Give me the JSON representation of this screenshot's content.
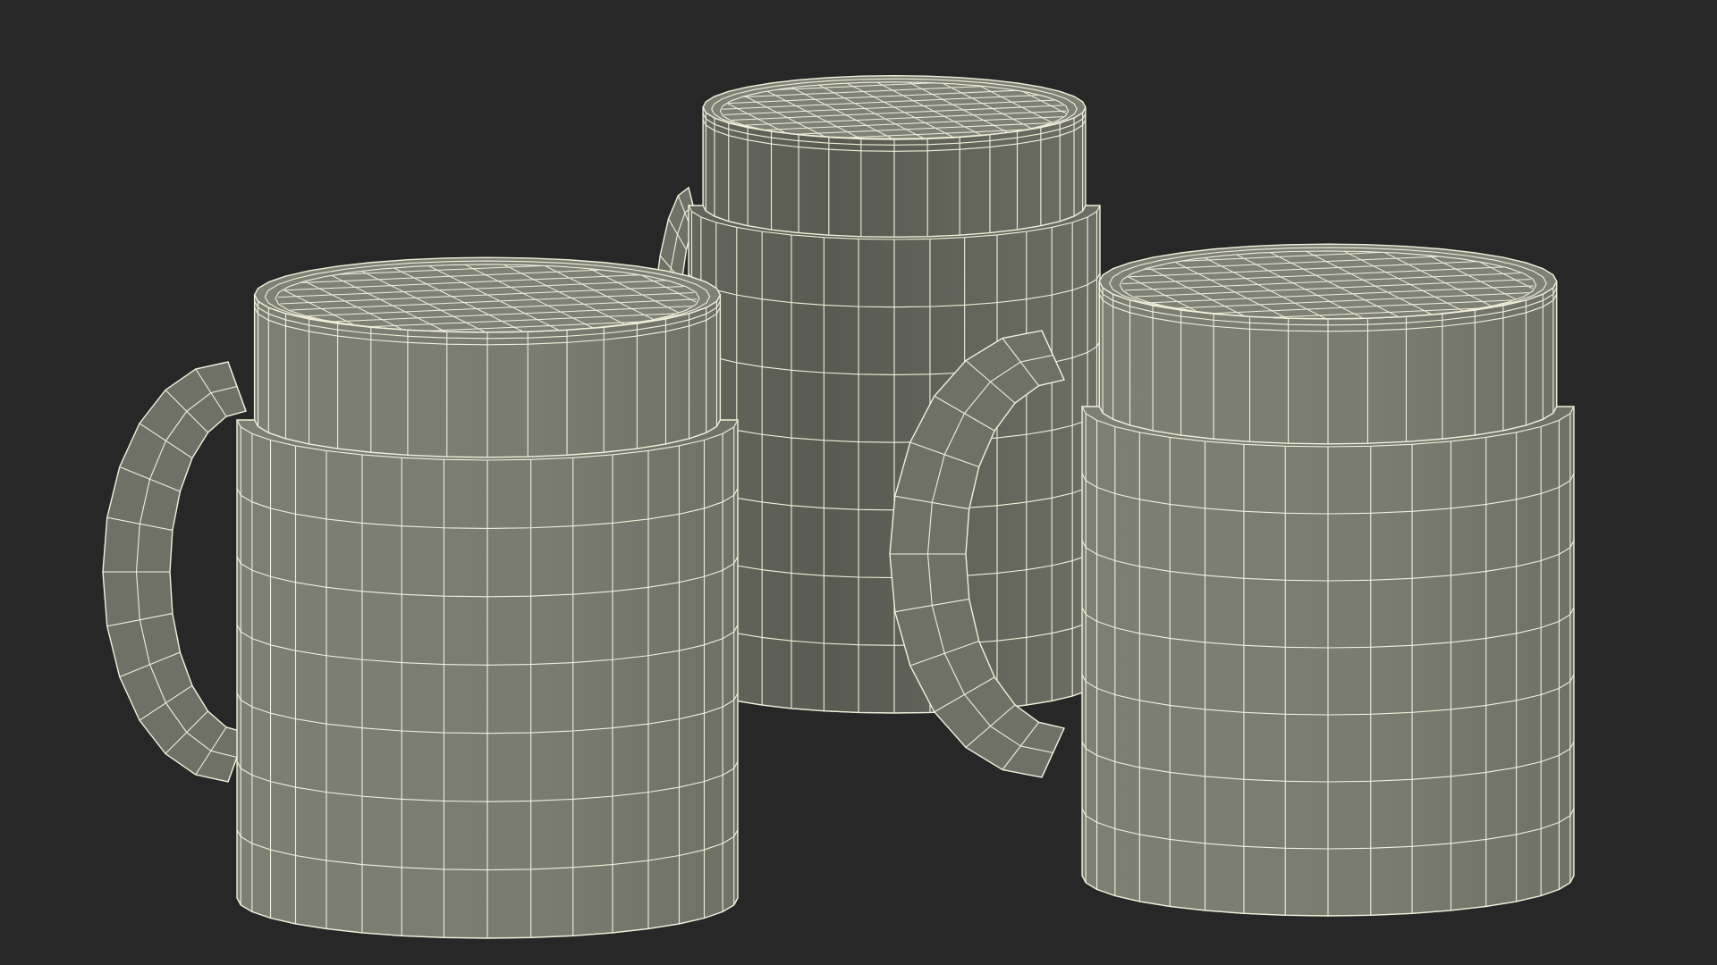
{
  "scene": {
    "background_color": "#272727",
    "body_color": "#7a7b70",
    "body_shadow_color": "#585a52",
    "top_color": "#7f8175",
    "wire_color": "#f2f0dc",
    "objects": [
      {
        "name": "mug-left",
        "handle": "left"
      },
      {
        "name": "mug-center",
        "handle": "left"
      },
      {
        "name": "mug-right",
        "handle": "left"
      }
    ]
  }
}
